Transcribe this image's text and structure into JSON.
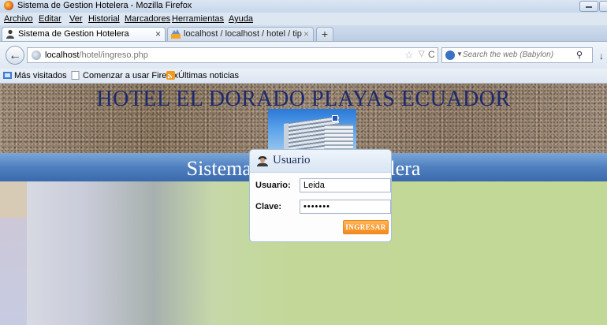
{
  "window": {
    "title": "Sistema de Gestion Hotelera - Mozilla Firefox"
  },
  "menu": {
    "items": [
      "Archivo",
      "Editar",
      "Ver",
      "Historial",
      "Marcadores",
      "Herramientas",
      "Ayuda"
    ]
  },
  "tabs": [
    {
      "label": "Sistema de Gestion Hotelera",
      "close": "×",
      "active": true
    },
    {
      "label": "localhost / localhost / hotel / tipousu...",
      "close": "×",
      "active": false
    }
  ],
  "new_tab_label": "+",
  "navigation": {
    "back_glyph": "←",
    "url_host": "localhost",
    "url_path": "/hotel/ingreso.php",
    "search_placeholder": "Search the web (Babylon)"
  },
  "bookmarks": {
    "items": [
      "Más visitados",
      "Comenzar a usar Firefox",
      "Últimas noticias"
    ]
  },
  "page": {
    "hotel_name": "HOTEL EL DORADO PLAYAS ECUADOR",
    "system_title": "Sistema de Gestion Hotelera"
  },
  "login": {
    "title": "Usuario",
    "username_label": "Usuario:",
    "username_value": "Leida",
    "password_label": "Clave:",
    "password_value": "•••••••",
    "submit_label": "INGRESAR"
  },
  "colors": {
    "banner_text": "#1d2a6d",
    "system_bar": "#4f7fbf",
    "submit_button": "#f58a1a",
    "main_background": "#c2d896"
  },
  "icons": [
    "firefox-icon",
    "user-tab-icon",
    "pma-tab-icon",
    "globe-icon",
    "star-icon",
    "reload-icon",
    "search-engine-icon",
    "magnifier-icon",
    "download-icon",
    "most-visited-icon",
    "page-icon",
    "rss-icon",
    "user-icon"
  ]
}
